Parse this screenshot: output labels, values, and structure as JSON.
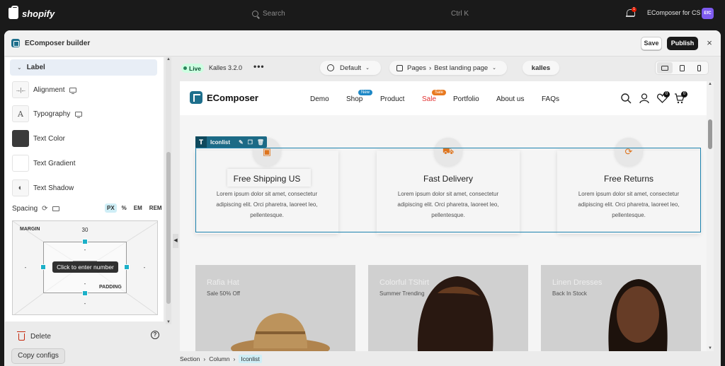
{
  "shopify": {
    "logo_text": "shopify",
    "search_placeholder": "Search",
    "search_shortcut": "Ctrl K",
    "notification_count": "1",
    "store_name": "EComposer for CS",
    "store_initials": "EfC"
  },
  "builder": {
    "title": "EComposer builder",
    "save_label": "Save",
    "publish_label": "Publish",
    "close_label": "×"
  },
  "panel": {
    "section_label": "Label",
    "options": [
      {
        "label": "Alignment",
        "icon": "align-center-icon",
        "glyph": "→|←"
      },
      {
        "label": "Typography",
        "icon": "typography-icon",
        "glyph": "A"
      },
      {
        "label": "Text Color",
        "icon": "color-swatch-icon",
        "glyph": ""
      },
      {
        "label": "Text Gradient",
        "icon": "gradient-swatch-icon",
        "glyph": ""
      },
      {
        "label": "Text Shadow",
        "icon": "shadow-icon",
        "glyph": "◐"
      }
    ],
    "text_color": "#3a3a3a",
    "spacing_label": "Spacing",
    "units": [
      "PX",
      "%",
      "EM",
      "REM"
    ],
    "active_unit": "PX",
    "margin_label": "MARGIN",
    "padding_label": "PADDING",
    "margin_top": "30",
    "margin_left": "-",
    "margin_right": "-",
    "margin_bottom": "-",
    "padding_top": "-",
    "padding_bottom": "-",
    "tooltip": "Click to enter number",
    "delete_label": "Delete",
    "help_label": "?",
    "copy_label": "Copy configs"
  },
  "canvas": {
    "live_label": "Live",
    "theme_version": "Kalles 3.2.0",
    "more_label": "•••",
    "template_label": "Default",
    "pages_label": "Pages",
    "page_name": "Best landing page",
    "theme_brand": "kalles",
    "breadcrumb": [
      "Section",
      "Column",
      "Iconlist"
    ]
  },
  "site": {
    "brand": "EComposer",
    "nav": [
      {
        "label": "Demo"
      },
      {
        "label": "Shop",
        "badge": "New"
      },
      {
        "label": "Product"
      },
      {
        "label": "Sale",
        "badge": "Sale"
      },
      {
        "label": "Portfolio"
      },
      {
        "label": "About us"
      },
      {
        "label": "FAQs"
      }
    ],
    "wishlist_count": "0",
    "cart_count": "0",
    "element_tag": "Iconlist",
    "features": [
      {
        "title": "Free Shipping US",
        "desc": "Lorem ipsum dolor sit amet, consectetur adipiscing elit. Orci pharetra, laoreet leo, pellentesque.",
        "icon": "box-icon"
      },
      {
        "title": "Fast Delivery",
        "desc": "Lorem ipsum dolor sit amet, consectetur adipiscing elit. Orci pharetra, laoreet leo, pellentesque.",
        "icon": "truck-icon"
      },
      {
        "title": "Free Returns",
        "desc": "Lorem ipsum dolor sit amet, consectetur adipiscing elit. Orci pharetra, laoreet leo, pellentesque.",
        "icon": "refresh-icon"
      }
    ],
    "banners": [
      {
        "title": "Rafia Hat",
        "subtitle": "Sale 50% Off"
      },
      {
        "title": "Colorful TShirt",
        "subtitle": "Summer Trending"
      },
      {
        "title": "Linen Dresses",
        "subtitle": "Back In Stock"
      }
    ]
  },
  "colors": {
    "accent": "#1cb0c8",
    "brand": "#1e6f8c",
    "sale": "#e23232",
    "publish_bg": "#1a1a1a"
  }
}
